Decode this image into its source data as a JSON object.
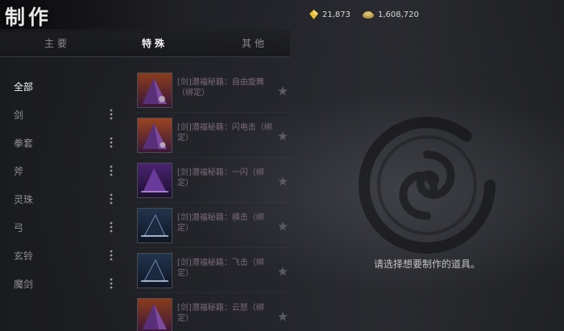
{
  "header": {
    "title": "制作"
  },
  "currency": {
    "gold_amount": "21,873",
    "silver_amount": "1,608,720"
  },
  "tabs": [
    {
      "label": "主要",
      "active": false
    },
    {
      "label": "特殊",
      "active": true
    },
    {
      "label": "其他",
      "active": false
    }
  ],
  "categories": [
    {
      "label": "全部",
      "active": true,
      "has_menu": false
    },
    {
      "label": "剑",
      "active": false,
      "has_menu": true
    },
    {
      "label": "拳套",
      "active": false,
      "has_menu": true
    },
    {
      "label": "斧",
      "active": false,
      "has_menu": true
    },
    {
      "label": "灵珠",
      "active": false,
      "has_menu": true
    },
    {
      "label": "弓",
      "active": false,
      "has_menu": true
    },
    {
      "label": "玄铃",
      "active": false,
      "has_menu": true
    },
    {
      "label": "魔剑",
      "active": false,
      "has_menu": true
    }
  ],
  "recipes": [
    {
      "name": "[剑]潜福秘籍：自由旋舞（绑定）",
      "icon": "purple-orange-scroll-icon"
    },
    {
      "name": "[剑]潜福秘籍：闪电击（绑定）",
      "icon": "purple-orange-scroll-icon"
    },
    {
      "name": "[剑]潜福秘籍：一闪（绑定）",
      "icon": "purple-scroll-icon"
    },
    {
      "name": "[剑]潜福秘籍：横击（绑定）",
      "icon": "blue-scroll-icon"
    },
    {
      "name": "[剑]潜福秘籍：飞击（绑定）",
      "icon": "blue-scroll-icon"
    },
    {
      "name": "[剑]潜福秘籍：云怒（绑定）",
      "icon": "purple-orange-scroll-icon"
    }
  ],
  "main": {
    "hint": "请选择想要制作的道具。"
  },
  "colors": {
    "accent_text": "#f2f2f2",
    "muted_text": "#8f8f8f",
    "recipe_text": "#7a6b7a",
    "gold": "#e6c02e"
  }
}
